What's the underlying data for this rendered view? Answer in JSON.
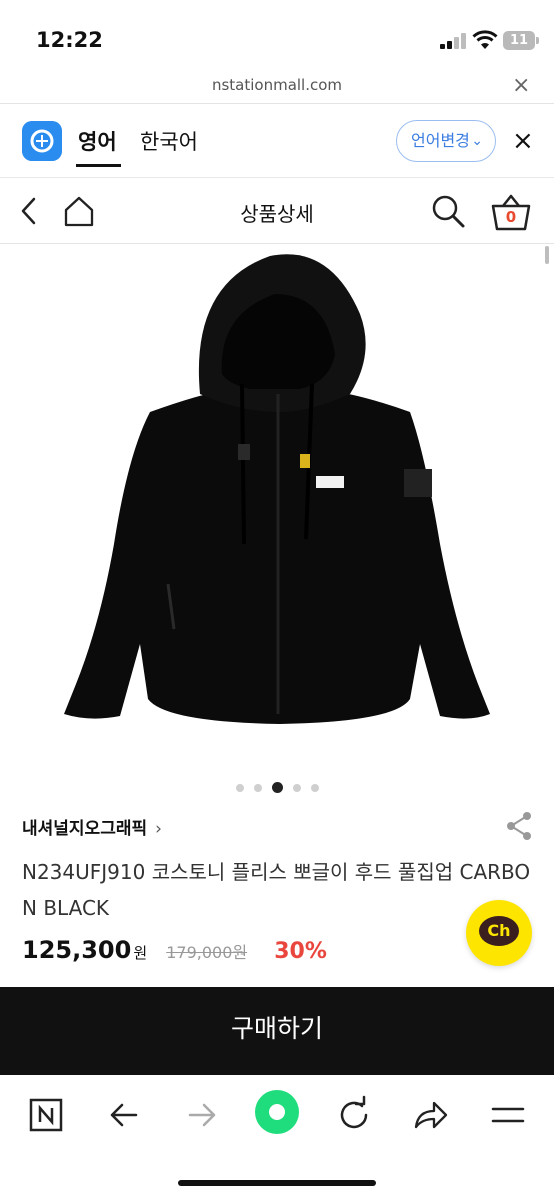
{
  "status_bar": {
    "time": "12:22",
    "battery": "11"
  },
  "url_bar": {
    "url": "nstationmall.com",
    "close_icon": "close-icon"
  },
  "translate_bar": {
    "tabs": [
      {
        "label": "영어"
      },
      {
        "label": "한국어"
      }
    ],
    "change_language": "언어변경",
    "close_icon": "close-icon"
  },
  "header": {
    "title": "상품상세",
    "cart_count": "0"
  },
  "carousel": {
    "total": 5,
    "active_index": 2
  },
  "product": {
    "brand": "내셔널지오그래픽",
    "brand_chevron": "›",
    "name": "N234UFJ910 코스토니 플리스 뽀글이 후드 풀집업 CARBON BLACK",
    "price": "125,300",
    "price_unit": "원",
    "original_price": "179,000원",
    "discount": "30%",
    "chat_label": "Ch"
  },
  "buy_button": {
    "label": "구매하기"
  },
  "colors": {
    "accent_blue": "#3b7de0",
    "discount_red": "#e9463d",
    "chat_yellow": "#fde500",
    "buy_bar": "#111111",
    "browser_green": "#1fdc7c"
  }
}
